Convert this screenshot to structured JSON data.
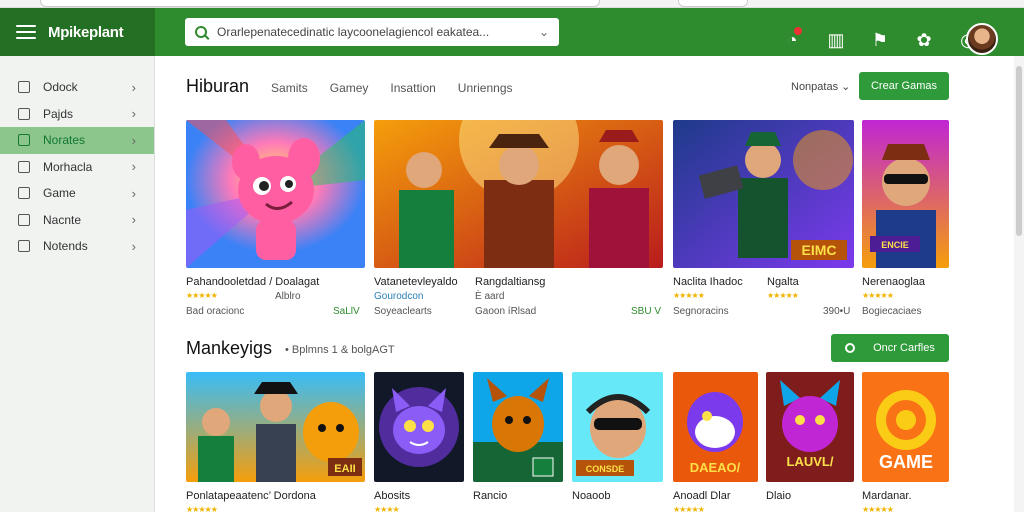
{
  "header": {
    "brand": "Mpikeplant",
    "search_value": "Orarlepenatecedinatic laycoonelagiencol eakatea...",
    "icons": [
      "clock-icon",
      "cart-icon",
      "flag-icon",
      "settings-icon",
      "whatsapp-icon",
      "avatar"
    ]
  },
  "sidebar": {
    "items": [
      {
        "label": "Odock"
      },
      {
        "label": "Pajds"
      },
      {
        "label": "Norates"
      },
      {
        "label": "Morhacla"
      },
      {
        "label": "Game"
      },
      {
        "label": "Nacnte"
      },
      {
        "label": "Notends"
      }
    ],
    "active_index": 2
  },
  "section1": {
    "title": "Hiburan",
    "tabs": [
      "Samits",
      "Gamey",
      "Insattion",
      "Unrienngs"
    ],
    "sort_label": "Nonpatas ⌄",
    "button": "Crear Gamas",
    "cards": [
      {
        "title": "Pahandooletdad / Doalagat",
        "meta1": "Alblro",
        "meta2": "Bad oracionc",
        "meta3": "SaLlV"
      },
      {
        "title": "Vatanetevleyaldo",
        "title2": "Rangdaltiansg",
        "meta1": "Gourodcon",
        "meta1b": "È aard",
        "meta2": "Soyeaclearts",
        "meta2b": "Gaoon íRlsad",
        "meta3": "SBU V"
      },
      {
        "title": "Naclita Ihadoc",
        "title2": "Ngalta",
        "meta2": "Segnoracins",
        "meta3": "390•U"
      },
      {
        "title": "Nerenaoglaa",
        "meta2": "Bogiecaciaes"
      }
    ]
  },
  "section2": {
    "title": "Mankeyigs",
    "subtitle": "• Bplmns 1 & bolgAGT",
    "button": "Oncr Carfles",
    "cards": [
      {
        "title": "Ponlatapeaatenc’ Dordona"
      },
      {
        "title": "Abosits"
      },
      {
        "title": "Rancio"
      },
      {
        "title": "Noaoob"
      },
      {
        "title": "Anoadl Dlar"
      },
      {
        "title": "Dlaio"
      },
      {
        "title": "Mardanar."
      }
    ],
    "badges": [
      "EAII",
      "CONSDE",
      "DAEAO/",
      "LAUVL/",
      "GAME"
    ]
  },
  "overlay_text": {
    "card3_label": "EIMC",
    "card4_label": "ENCIE"
  }
}
